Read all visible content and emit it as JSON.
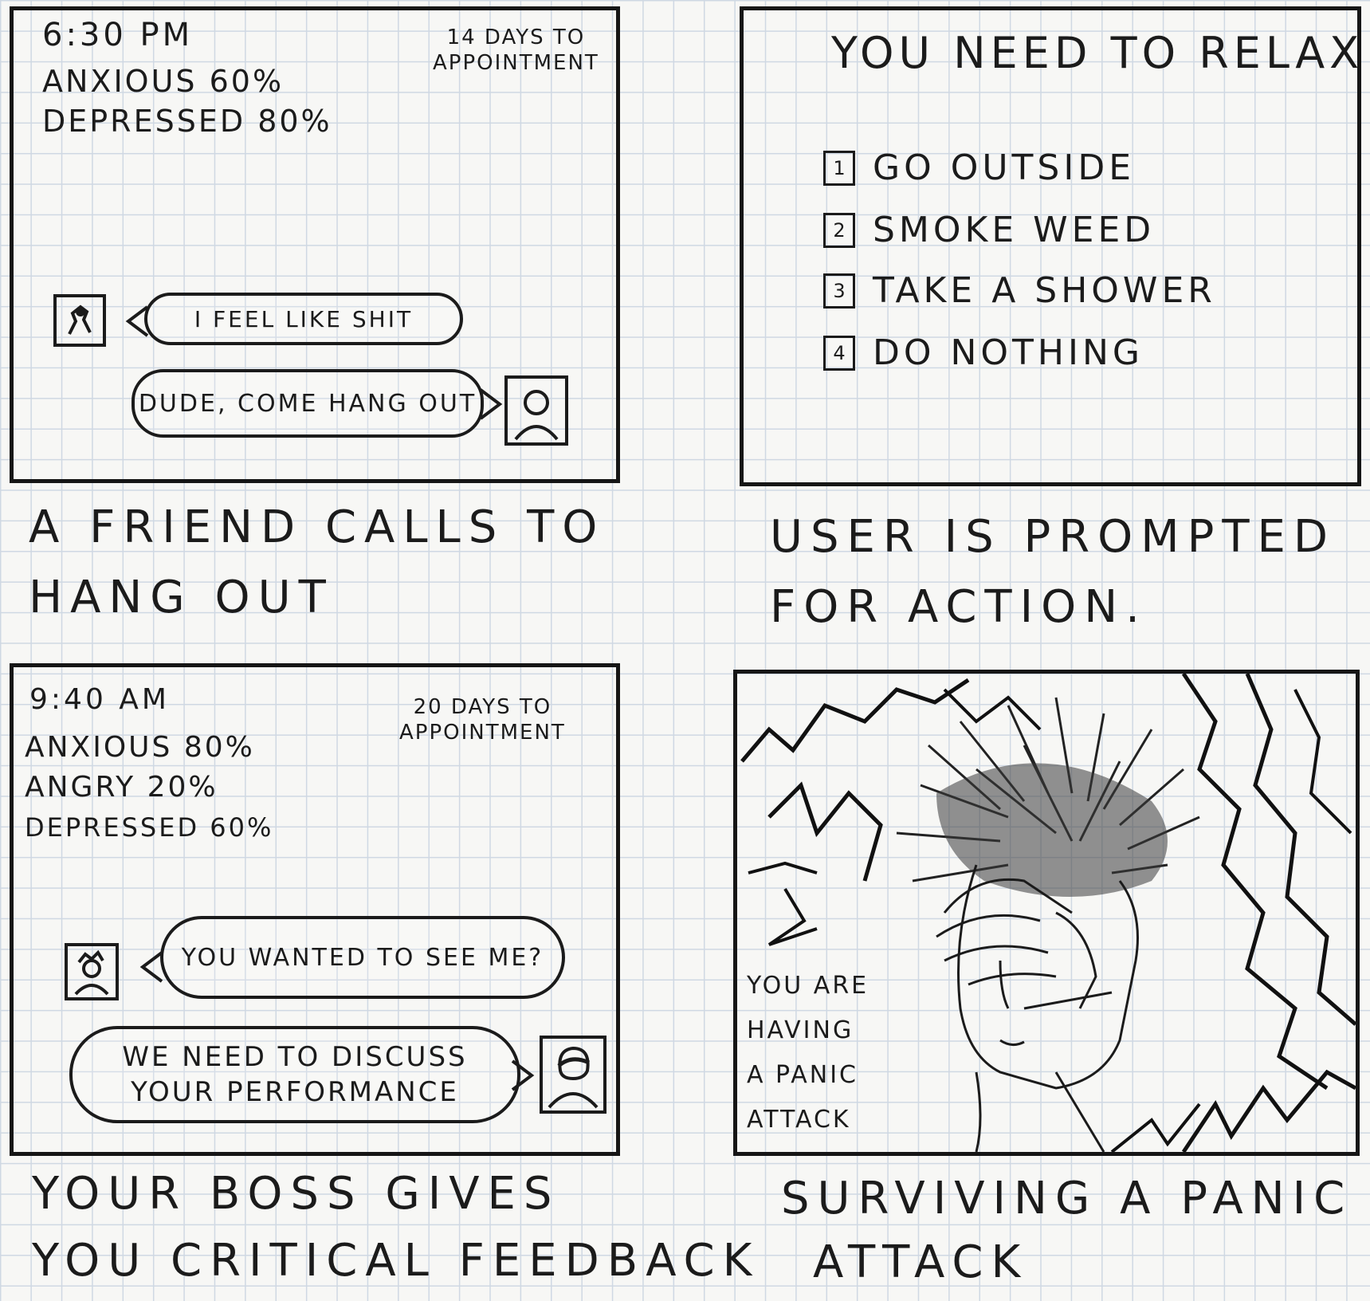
{
  "panels": [
    {
      "time": "6:30 PM",
      "stats": [
        "ANXIOUS 60%",
        "DEPRESSED 80%"
      ],
      "appointment": [
        "14 DAYS TO",
        "APPOINTMENT"
      ],
      "bubble_user": "I FEEL LIKE SHIT",
      "bubble_other": "DUDE, COME HANG OUT",
      "caption": [
        "A FRIEND CALLS TO",
        "HANG OUT"
      ]
    },
    {
      "title": "YOU NEED TO RELAX",
      "options": [
        {
          "num": "1",
          "label": "GO OUTSIDE"
        },
        {
          "num": "2",
          "label": "SMOKE WEED"
        },
        {
          "num": "3",
          "label": "TAKE A SHOWER"
        },
        {
          "num": "4",
          "label": "DO NOTHING"
        }
      ],
      "caption": [
        "USER IS PROMPTED",
        "FOR ACTION."
      ]
    },
    {
      "time": "9:40 AM",
      "stats": [
        "ANXIOUS 80%",
        "ANGRY 20%",
        "DEPRESSED 60%"
      ],
      "appointment": [
        "20 DAYS TO",
        "APPOINTMENT"
      ],
      "bubble_user": "YOU WANTED TO SEE ME?",
      "bubble_other": [
        "WE NEED TO DISCUSS",
        "YOUR PERFORMANCE"
      ],
      "caption": [
        "YOUR BOSS GIVES",
        "YOU CRITICAL FEEDBACK"
      ]
    },
    {
      "message": [
        "YOU ARE",
        "HAVING",
        "A PANIC",
        "ATTACK"
      ],
      "caption": [
        "SURVIVING A PANIC",
        "ATTACK"
      ]
    }
  ]
}
